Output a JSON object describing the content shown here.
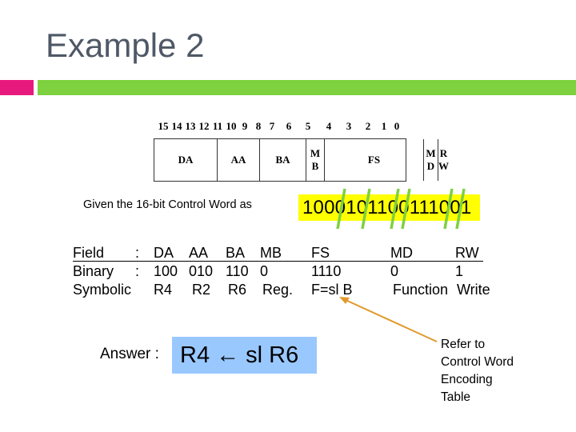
{
  "slide": {
    "title": "Example 2",
    "accent_colors": {
      "pink": "#e8197c",
      "green": "#7ed13f",
      "title_text": "#4f5866"
    }
  },
  "control_word_format": {
    "bit_numbers": [
      "15",
      "14",
      "13",
      "12",
      "11",
      "10",
      "9",
      "8",
      "7",
      "6",
      "5",
      "4",
      "3",
      "2",
      "1",
      "0"
    ],
    "fields": [
      {
        "name": "DA",
        "bits": 3
      },
      {
        "name": "AA",
        "bits": 3
      },
      {
        "name": "BA",
        "bits": 3
      },
      {
        "name": "M\nB",
        "bits": 1
      },
      {
        "name": "FS",
        "bits": 4
      },
      {
        "name": "M\nD",
        "bits": 1
      },
      {
        "name": "R\nW",
        "bits": 1
      }
    ]
  },
  "given": {
    "label": "Given the 16-bit Control Word as",
    "value": "1000101100111001",
    "highlight_color": "#ffff00",
    "divider_color": "#7ed13f"
  },
  "decode_table": {
    "row_labels": [
      "Field",
      "Binary",
      "Symbolic"
    ],
    "separators": [
      ":",
      ":",
      ""
    ],
    "columns": [
      {
        "field": "DA",
        "binary": "100",
        "symbolic": "R4"
      },
      {
        "field": "AA",
        "binary": "010",
        "symbolic": "R2"
      },
      {
        "field": "BA",
        "binary": "110",
        "symbolic": "R6"
      },
      {
        "field": "MB",
        "binary": "0",
        "symbolic": "Reg."
      },
      {
        "field": "FS",
        "binary": "1110",
        "symbolic": "F=sl B"
      },
      {
        "field": "MD",
        "binary": "0",
        "symbolic": "Function"
      },
      {
        "field": "RW",
        "binary": "1",
        "symbolic": "Write"
      }
    ]
  },
  "answer": {
    "label": "Answer :",
    "value": "R4 ← sl R6",
    "highlight_color": "#99c8ff"
  },
  "note": {
    "lines": [
      "Refer to",
      "Control Word",
      "Encoding",
      "Table"
    ],
    "arrow_color": "#e09a2a"
  }
}
